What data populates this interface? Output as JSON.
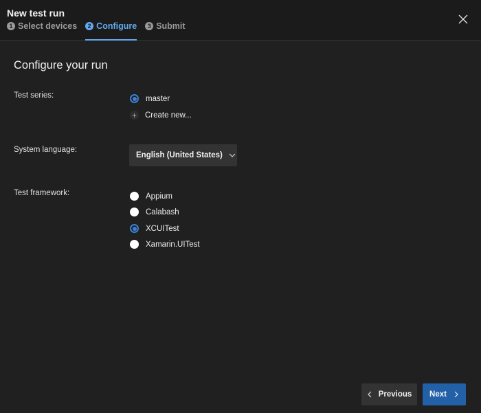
{
  "dialog": {
    "title": "New test run",
    "close_icon": "close-icon"
  },
  "steps": [
    {
      "number": "1",
      "label": "Select devices",
      "active": false
    },
    {
      "number": "2",
      "label": "Configure",
      "active": true
    },
    {
      "number": "3",
      "label": "Submit",
      "active": false
    }
  ],
  "main": {
    "heading": "Configure your run",
    "test_series": {
      "label": "Test series:",
      "options": [
        {
          "label": "master",
          "selected": true
        }
      ],
      "create_new_label": "Create new..."
    },
    "system_language": {
      "label": "System language:",
      "selected": "English (United States)"
    },
    "test_framework": {
      "label": "Test framework:",
      "options": [
        {
          "label": "Appium",
          "selected": false
        },
        {
          "label": "Calabash",
          "selected": false
        },
        {
          "label": "XCUITest",
          "selected": true
        },
        {
          "label": "Xamarin.UITest",
          "selected": false
        }
      ]
    }
  },
  "footer": {
    "previous_label": "Previous",
    "next_label": "Next"
  },
  "colors": {
    "accent": "#62a9ef",
    "primary_button": "#2260a8",
    "radio_selected": "#3b82d6",
    "background": "#202020",
    "header_background": "#1b1b1b"
  }
}
